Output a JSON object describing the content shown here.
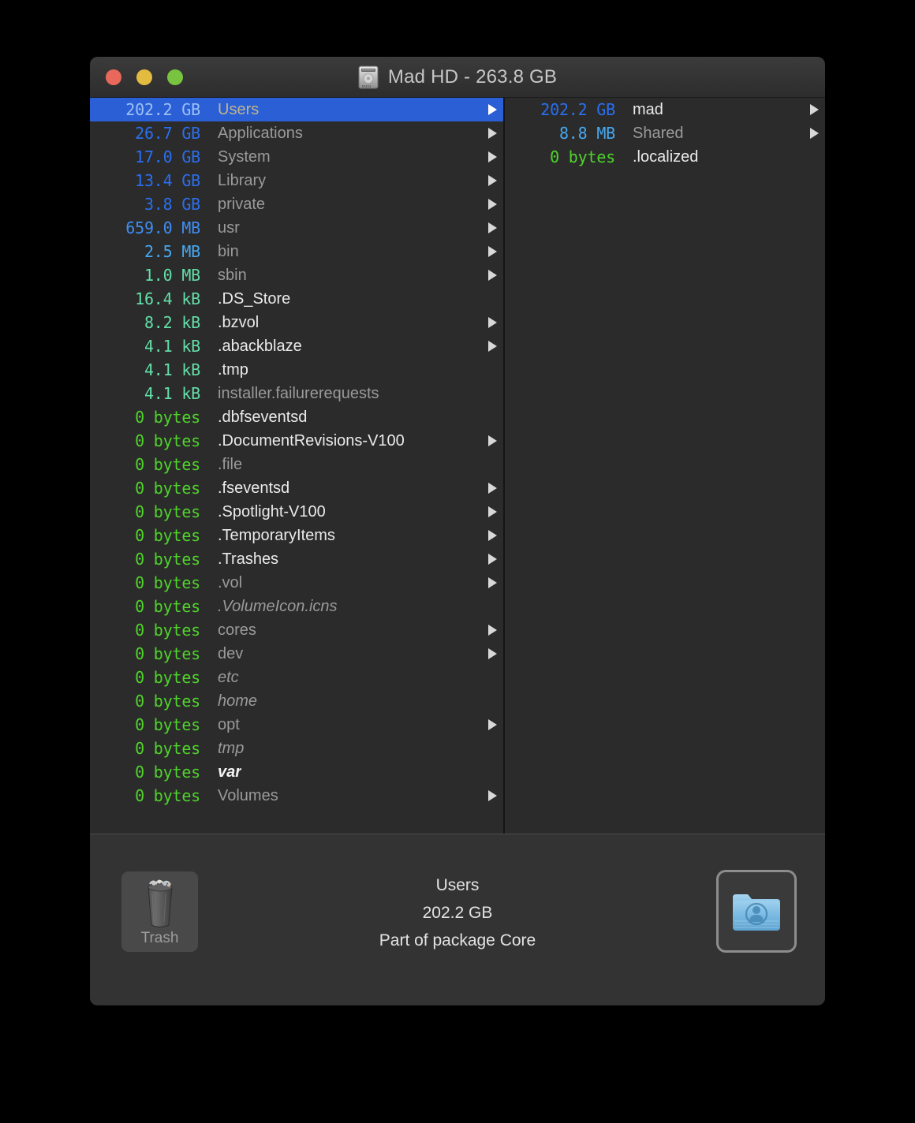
{
  "window": {
    "title": "Mad HD - 263.8 GB",
    "title_icon": "hard-drive-icon",
    "traffic_lights": [
      {
        "name": "close-button",
        "color": "#e8685c"
      },
      {
        "name": "minimize-button",
        "color": "#e3bb41"
      },
      {
        "name": "maximize-button",
        "color": "#78c440"
      }
    ]
  },
  "colors": {
    "selection": "#2a5fd6",
    "size_gb": "#2a6ff0",
    "size_mb": "#46c8f0",
    "size_kb": "#6ee0a8",
    "size_bytes": "#4fd42a",
    "name_dim": "#9a9a9a",
    "name_bright": "#eaeaea",
    "background": "#2b2b2b",
    "bottom_bar": "#333333"
  },
  "left_pane": {
    "name": "volume-contents-list",
    "rows": [
      {
        "size": "202.2 GB",
        "name": "Users",
        "size_color": "#2a6ff0",
        "name_style": "dim",
        "has_arrow": true,
        "selected": true
      },
      {
        "size": "26.7 GB",
        "name": "Applications",
        "size_color": "#2a6ff0",
        "name_style": "dim",
        "has_arrow": true,
        "selected": false
      },
      {
        "size": "17.0 GB",
        "name": "System",
        "size_color": "#2a6ff0",
        "name_style": "dim",
        "has_arrow": true,
        "selected": false
      },
      {
        "size": "13.4 GB",
        "name": "Library",
        "size_color": "#2a6ff0",
        "name_style": "dim",
        "has_arrow": true,
        "selected": false
      },
      {
        "size": "3.8 GB",
        "name": "private",
        "size_color": "#2a6ff0",
        "name_style": "dim",
        "has_arrow": true,
        "selected": false
      },
      {
        "size": "659.0 MB",
        "name": "usr",
        "size_color": "#3e8ef5",
        "name_style": "dim",
        "has_arrow": true,
        "selected": false
      },
      {
        "size": "2.5 MB",
        "name": "bin",
        "size_color": "#46a8f0",
        "name_style": "dim",
        "has_arrow": true,
        "selected": false
      },
      {
        "size": "1.0 MB",
        "name": "sbin",
        "size_color": "#63dfa8",
        "name_style": "dim",
        "has_arrow": true,
        "selected": false
      },
      {
        "size": "16.4 kB",
        "name": ".DS_Store",
        "size_color": "#63dfa8",
        "name_style": "bright",
        "has_arrow": false,
        "selected": false
      },
      {
        "size": "8.2 kB",
        "name": ".bzvol",
        "size_color": "#63dfa8",
        "name_style": "bright",
        "has_arrow": true,
        "selected": false
      },
      {
        "size": "4.1 kB",
        "name": ".abackblaze",
        "size_color": "#63dfa8",
        "name_style": "bright",
        "has_arrow": true,
        "selected": false
      },
      {
        "size": "4.1 kB",
        "name": ".tmp",
        "size_color": "#63dfa8",
        "name_style": "bright",
        "has_arrow": false,
        "selected": false
      },
      {
        "size": "4.1 kB",
        "name": "installer.failurerequests",
        "size_color": "#63dfa8",
        "name_style": "dim",
        "has_arrow": false,
        "selected": false
      },
      {
        "size": "0 bytes",
        "name": ".dbfseventsd",
        "size_color": "#4fd42a",
        "name_style": "bright",
        "has_arrow": false,
        "selected": false
      },
      {
        "size": "0 bytes",
        "name": ".DocumentRevisions-V100",
        "size_color": "#4fd42a",
        "name_style": "bright",
        "has_arrow": true,
        "selected": false
      },
      {
        "size": "0 bytes",
        "name": ".file",
        "size_color": "#4fd42a",
        "name_style": "dim",
        "has_arrow": false,
        "selected": false
      },
      {
        "size": "0 bytes",
        "name": ".fseventsd",
        "size_color": "#4fd42a",
        "name_style": "bright",
        "has_arrow": true,
        "selected": false
      },
      {
        "size": "0 bytes",
        "name": ".Spotlight-V100",
        "size_color": "#4fd42a",
        "name_style": "bright",
        "has_arrow": true,
        "selected": false
      },
      {
        "size": "0 bytes",
        "name": ".TemporaryItems",
        "size_color": "#4fd42a",
        "name_style": "bright",
        "has_arrow": true,
        "selected": false
      },
      {
        "size": "0 bytes",
        "name": ".Trashes",
        "size_color": "#4fd42a",
        "name_style": "bright",
        "has_arrow": true,
        "selected": false
      },
      {
        "size": "0 bytes",
        "name": ".vol",
        "size_color": "#4fd42a",
        "name_style": "dim",
        "has_arrow": true,
        "selected": false
      },
      {
        "size": "0 bytes",
        "name": ".VolumeIcon.icns",
        "size_color": "#4fd42a",
        "name_style": "italic",
        "has_arrow": false,
        "selected": false
      },
      {
        "size": "0 bytes",
        "name": "cores",
        "size_color": "#4fd42a",
        "name_style": "dim",
        "has_arrow": true,
        "selected": false
      },
      {
        "size": "0 bytes",
        "name": "dev",
        "size_color": "#4fd42a",
        "name_style": "dim",
        "has_arrow": true,
        "selected": false
      },
      {
        "size": "0 bytes",
        "name": "etc",
        "size_color": "#4fd42a",
        "name_style": "italic",
        "has_arrow": false,
        "selected": false
      },
      {
        "size": "0 bytes",
        "name": "home",
        "size_color": "#4fd42a",
        "name_style": "italic",
        "has_arrow": false,
        "selected": false
      },
      {
        "size": "0 bytes",
        "name": "opt",
        "size_color": "#4fd42a",
        "name_style": "dim",
        "has_arrow": true,
        "selected": false
      },
      {
        "size": "0 bytes",
        "name": "tmp",
        "size_color": "#4fd42a",
        "name_style": "italic",
        "has_arrow": false,
        "selected": false
      },
      {
        "size": "0 bytes",
        "name": "var",
        "size_color": "#4fd42a",
        "name_style": "bolditalic",
        "has_arrow": false,
        "selected": false
      },
      {
        "size": "0 bytes",
        "name": "Volumes",
        "size_color": "#4fd42a",
        "name_style": "dim",
        "has_arrow": true,
        "selected": false
      }
    ]
  },
  "right_pane": {
    "name": "users-folder-contents-list",
    "rows": [
      {
        "size": "202.2 GB",
        "name": "mad",
        "size_color": "#2a6ff0",
        "name_style": "bright",
        "has_arrow": true,
        "selected": false
      },
      {
        "size": "8.8 MB",
        "name": "Shared",
        "size_color": "#46a8f0",
        "name_style": "dim",
        "has_arrow": true,
        "selected": false
      },
      {
        "size": "0 bytes",
        "name": ".localized",
        "size_color": "#4fd42a",
        "name_style": "bright",
        "has_arrow": false,
        "selected": false
      }
    ]
  },
  "bottom_bar": {
    "trash_label": "Trash",
    "trash_icon": "trash-full-icon",
    "selection_icon": "users-folder-icon",
    "info": {
      "name": "Users",
      "size": "202.2 GB",
      "package": "Part of package Core"
    }
  }
}
